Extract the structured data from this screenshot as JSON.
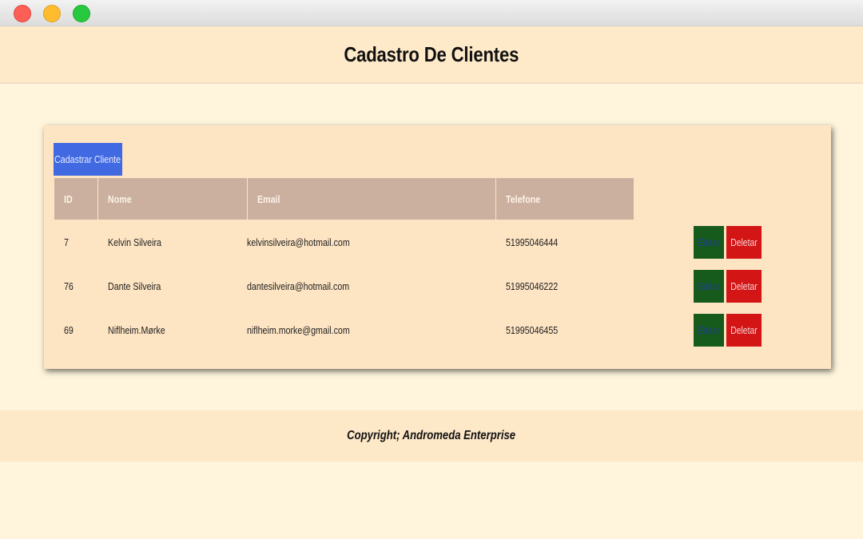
{
  "header": {
    "title": "Cadastro De Clientes"
  },
  "toolbar": {
    "new_client_label": "Cadastrar Cliente"
  },
  "table": {
    "columns": [
      "ID",
      "Nome",
      "Email",
      "Telefone"
    ],
    "rows": [
      {
        "id": "7",
        "nome": "Kelvin Silveira",
        "email": "kelvinsilveira@hotmail.com",
        "telefone": "51995046444"
      },
      {
        "id": "76",
        "nome": "Dante Silveira",
        "email": "dantesilveira@hotmail.com",
        "telefone": "51995046222"
      },
      {
        "id": "69",
        "nome": "Niflheim.Mørke",
        "email": "niflheim.morke@gmail.com",
        "telefone": "51995046455"
      }
    ],
    "actions": {
      "edit_label": "Editar",
      "delete_label": "Deletar"
    }
  },
  "footer": {
    "text": "Copyright; Andromeda Enterprise"
  },
  "colors": {
    "page_bg": "#fef5dc",
    "header_bg": "#feeac8",
    "card_bg": "#fde4c3",
    "primary_button": "#4169e1",
    "table_header_bg": "#cbb0a0",
    "edit_button": "#165a1c",
    "delete_button": "#d41515"
  }
}
